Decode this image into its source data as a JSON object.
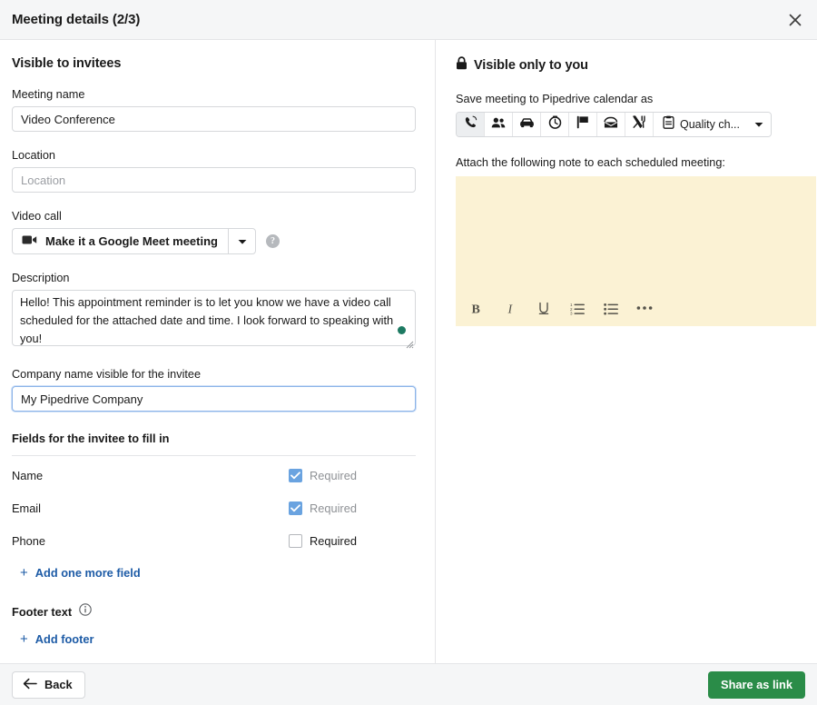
{
  "header": {
    "title": "Meeting details (2/3)",
    "close_icon": "close-icon"
  },
  "left_panel": {
    "section_title": "Visible to invitees",
    "meeting_name": {
      "label": "Meeting name",
      "value": "Video Conference"
    },
    "location": {
      "label": "Location",
      "value": "",
      "placeholder": "Location"
    },
    "video_call": {
      "label": "Video call",
      "button_label": "Make it a Google Meet meeting",
      "icon": "video-camera-icon",
      "caret_icon": "chevron-down-icon",
      "help_icon": "help-circle-icon",
      "help_glyph": "?"
    },
    "description": {
      "label": "Description",
      "value": "Hello! This appointment reminder is to let you know we have a video call scheduled for the attached date and time. I look forward to speaking with you!"
    },
    "company_name": {
      "label": "Company name visible for the invitee",
      "value": "My Pipedrive Company"
    },
    "fields_section": {
      "heading": "Fields for the invitee to fill in",
      "rows": [
        {
          "name": "Name",
          "required_label": "Required",
          "checked": true,
          "disabled": true
        },
        {
          "name": "Email",
          "required_label": "Required",
          "checked": true,
          "disabled": true
        },
        {
          "name": "Phone",
          "required_label": "Required",
          "checked": false,
          "disabled": false
        }
      ],
      "add_field_label": "Add one more field",
      "add_field_icon": "plus-icon"
    },
    "footer_section": {
      "heading": "Footer text",
      "info_icon": "info-circle-icon",
      "add_footer_label": "Add footer",
      "add_footer_icon": "plus-icon"
    }
  },
  "right_panel": {
    "section_title": "Visible only to you",
    "lock_icon": "lock-icon",
    "calendar_label": "Save meeting to Pipedrive calendar as",
    "activity_types": [
      {
        "name": "phone-icon",
        "label": "Call",
        "selected": true
      },
      {
        "name": "people-icon",
        "label": "Meeting",
        "selected": false
      },
      {
        "name": "car-icon",
        "label": "Deal",
        "selected": false
      },
      {
        "name": "clock-icon",
        "label": "Task",
        "selected": false
      },
      {
        "name": "flag-icon",
        "label": "Deadline",
        "selected": false
      },
      {
        "name": "email-icon",
        "label": "Email",
        "selected": false
      },
      {
        "name": "lunch-icon",
        "label": "Lunch",
        "selected": false
      }
    ],
    "activity_dropdown": {
      "icon": "clipboard-icon",
      "label": "Quality ch...",
      "caret_icon": "chevron-down-icon"
    },
    "note": {
      "label": "Attach the following note to each scheduled meeting:",
      "value": "",
      "background_color": "#fbf2d4",
      "toolbar": [
        {
          "name": "bold-icon",
          "glyph": "B"
        },
        {
          "name": "italic-icon",
          "glyph": "I"
        },
        {
          "name": "underline-icon",
          "glyph": "U"
        },
        {
          "name": "numbered-list-icon",
          "glyph": ""
        },
        {
          "name": "bulleted-list-icon",
          "glyph": ""
        },
        {
          "name": "more-options-icon",
          "glyph": ""
        }
      ]
    }
  },
  "bottom_bar": {
    "back_label": "Back",
    "back_icon": "arrow-left-icon",
    "share_label": "Share as link"
  },
  "colors": {
    "accent_green": "#2a8c48",
    "link_blue": "#1d5ba6",
    "checkbox_blue": "#6aa3e0",
    "note_yellow": "#fbf2d4",
    "header_grey": "#f5f6f7",
    "border_grey": "#d6d8db"
  }
}
